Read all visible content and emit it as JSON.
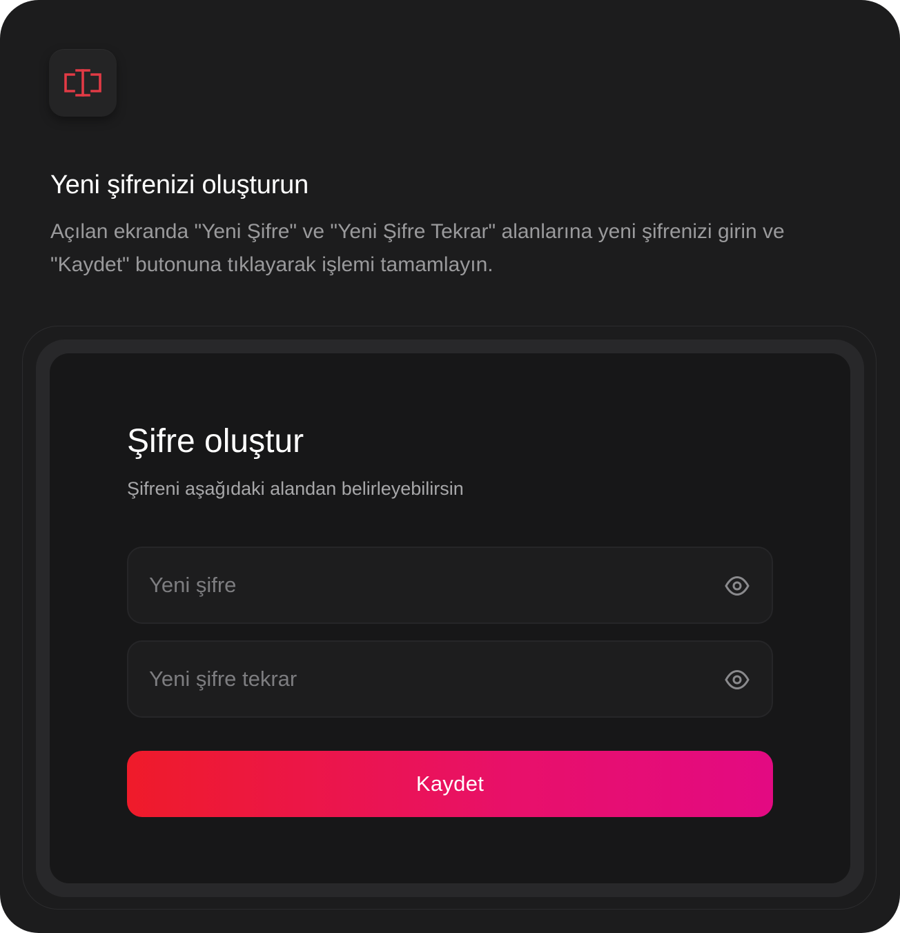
{
  "intro": {
    "title": "Yeni şifrenizi oluşturun",
    "description": "Açılan ekranda \"Yeni Şifre\" ve \"Yeni Şifre Tekrar\" alanlarına yeni şifrenizi girin ve \"Kaydet\" butonuna tıklayarak işlemi tamamlayın."
  },
  "form": {
    "title": "Şifre oluştur",
    "subtitle": "Şifreni aşağıdaki alandan belirleyebilirsin",
    "password": {
      "placeholder": "Yeni şifre",
      "value": "",
      "icon": "eye-icon"
    },
    "password_repeat": {
      "placeholder": "Yeni şifre tekrar",
      "value": "",
      "icon": "eye-icon"
    },
    "save_label": "Kaydet"
  },
  "logo": {
    "icon": "text-cursor-icon",
    "color": "#e23a45"
  },
  "colors": {
    "background": "#1c1c1d",
    "panel": "#171718",
    "accent_start": "#ef1b2a",
    "accent_end": "#e30a82"
  }
}
